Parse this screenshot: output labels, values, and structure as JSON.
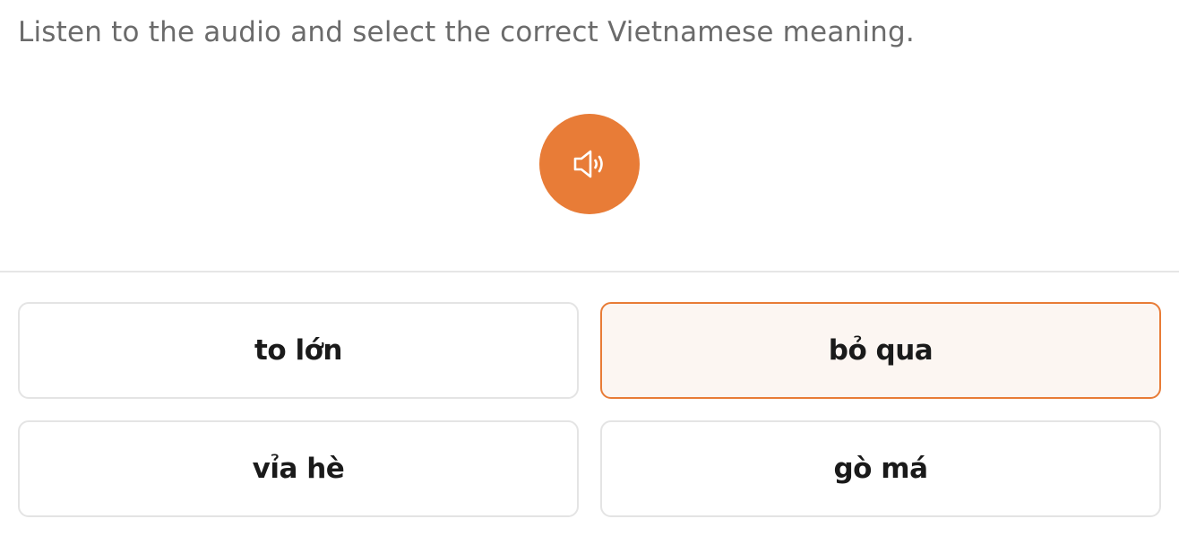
{
  "instruction": "Listen to the audio and select the correct Vietnamese meaning.",
  "audio_button": {
    "icon": "speaker-icon",
    "color": "#e87c37"
  },
  "options": [
    {
      "label": "to lớn",
      "selected": false
    },
    {
      "label": "bỏ qua",
      "selected": true
    },
    {
      "label": "vỉa hè",
      "selected": false
    },
    {
      "label": "gò má",
      "selected": false
    }
  ],
  "colors": {
    "accent": "#e87c37",
    "selected_background": "#fcf6f2",
    "border": "#e4e4e4",
    "instruction_text": "#6b6b6b"
  }
}
